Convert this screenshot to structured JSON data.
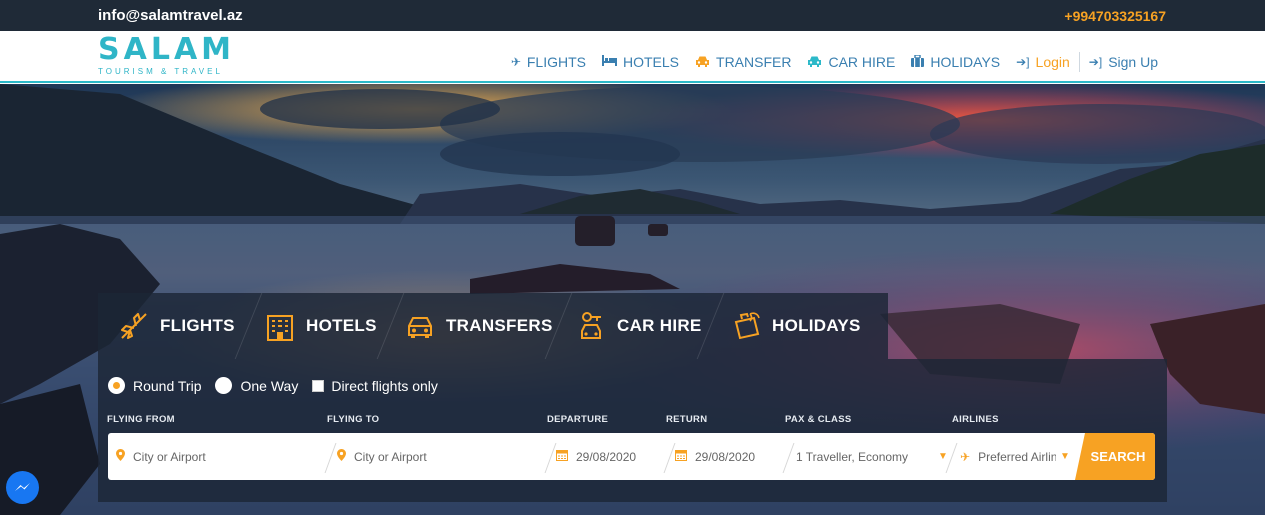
{
  "topbar": {
    "email": "info@salamtravel.az",
    "phone": "+994703325167"
  },
  "logo": {
    "brand": "SALAM",
    "tagline": "TOURISM & TRAVEL"
  },
  "nav": {
    "items": [
      {
        "label": "FLIGHTS",
        "icon": "plane-icon"
      },
      {
        "label": "HOTELS",
        "icon": "bed-icon"
      },
      {
        "label": "TRANSFER",
        "icon": "taxi-icon"
      },
      {
        "label": "CAR HIRE",
        "icon": "car-icon"
      },
      {
        "label": "HOLIDAYS",
        "icon": "suitcase-icon"
      }
    ],
    "login": "Login",
    "signup": "Sign Up"
  },
  "search_tabs": [
    {
      "label": "FLIGHTS",
      "icon": "plane-icon"
    },
    {
      "label": "HOTELS",
      "icon": "hotel-building-icon"
    },
    {
      "label": "TRANSFERS",
      "icon": "taxi-icon"
    },
    {
      "label": "CAR HIRE",
      "icon": "car-key-icon"
    },
    {
      "label": "HOLIDAYS",
      "icon": "holiday-suitcase-icon"
    }
  ],
  "trip_type": {
    "round_trip": "Round Trip",
    "one_way": "One Way",
    "direct_only": "Direct flights only",
    "selected": "Round Trip"
  },
  "form": {
    "labels": {
      "from": "FLYING FROM",
      "to": "FLYING TO",
      "departure": "DEPARTURE",
      "return": "RETURN",
      "pax": "PAX & CLASS",
      "airlines": "AIRLINES"
    },
    "from_placeholder": "City or Airport",
    "to_placeholder": "City or Airport",
    "departure_value": "29/08/2020",
    "return_value": "29/08/2020",
    "pax_value": "1 Traveller, Economy",
    "airline_placeholder": "Preferred Airline",
    "search_label": "SEARCH"
  },
  "colors": {
    "accent": "#f7a223",
    "brand": "#2fb5c7",
    "topbar": "#1f2a37",
    "nav_link": "#3a7fb0"
  }
}
